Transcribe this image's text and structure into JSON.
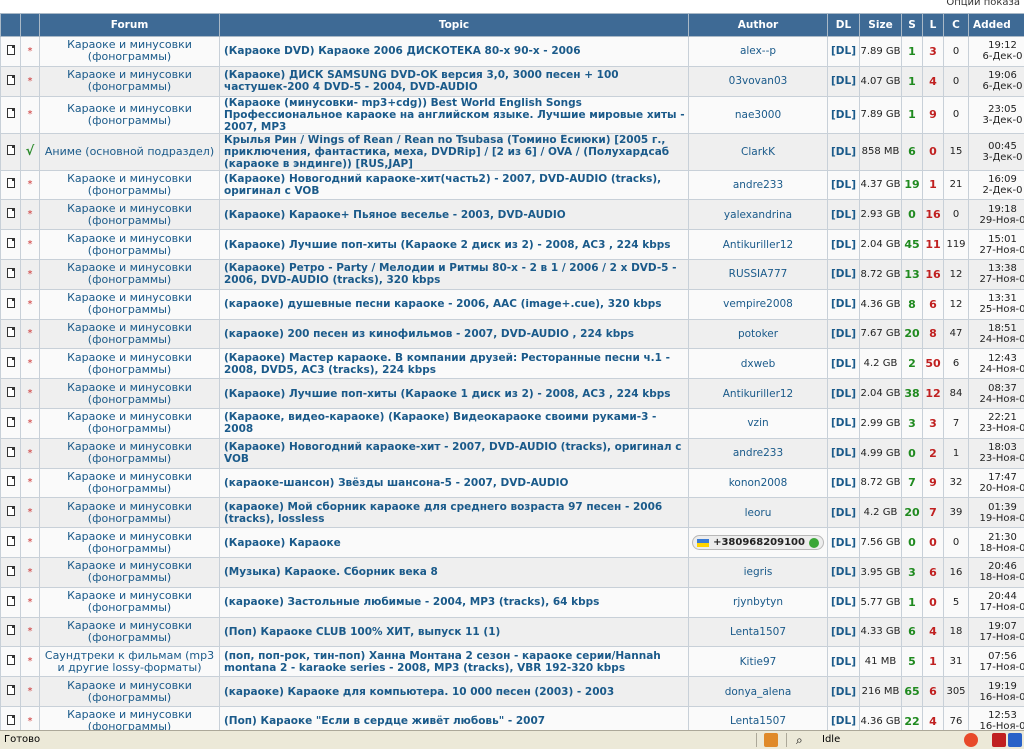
{
  "header": {
    "options_label": "Опции показа"
  },
  "columns": [
    "Forum",
    "Topic",
    "Author",
    "DL",
    "Size",
    "S",
    "L",
    "C",
    "Added"
  ],
  "rows": [
    {
      "status": "*",
      "forum": "Караоке и минусовки (фонограммы)",
      "topic": "(Караоке DVD) Караоке 2006 ДИСКОТЕКА 80-х 90-х - 2006",
      "author": "alex--p",
      "dl": "[DL]",
      "size": "7.89 GB",
      "s": "1",
      "l": "3",
      "c": "0",
      "time": "19:12",
      "date": "6-Дек-0"
    },
    {
      "status": "*",
      "forum": "Караоке и минусовки (фонограммы)",
      "topic": "(Караоке) ДИСК SAMSUNG DVD-OK версия 3,0, 3000 песен + 100 частушек-200 4 DVD-5 - 2004, DVD-AUDIO",
      "author": "03vovan03",
      "dl": "[DL]",
      "size": "4.07 GB",
      "s": "1",
      "l": "4",
      "c": "0",
      "time": "19:06",
      "date": "6-Дек-0"
    },
    {
      "status": "*",
      "forum": "Караоке и минусовки (фонограммы)",
      "topic": "(Караоке (минусовки- mp3+cdg)) Best World English Songs Профессиональное караоке на английском языке. Лучшие мировые хиты - 2007, MP3",
      "author": "nae3000",
      "dl": "[DL]",
      "size": "7.89 GB",
      "s": "1",
      "l": "9",
      "c": "0",
      "time": "23:05",
      "date": "3-Дек-0"
    },
    {
      "status": "√",
      "forum": "Аниме (основной подраздел)",
      "topic": "Крылья Рин / Wings of Rean / Rean no Tsubasa (Томино Ёсиюки) [2005 г., приключения, фантастика, меха, DVDRip] / [2 из 6] / OVA / (Полухардсаб (караоке в эндинге)) [RUS,JAP]",
      "author": "ClarkK",
      "dl": "[DL]",
      "size": "858 MB",
      "s": "6",
      "l": "0",
      "c": "15",
      "time": "00:45",
      "date": "3-Дек-0"
    },
    {
      "status": "*",
      "forum": "Караоке и минусовки (фонограммы)",
      "topic": "(Караоке) Новогодний караоке-хит(часть2) - 2007, DVD-AUDIO (tracks), оригинал с VOB",
      "author": "andre233",
      "dl": "[DL]",
      "size": "4.37 GB",
      "s": "19",
      "l": "1",
      "c": "21",
      "time": "16:09",
      "date": "2-Дек-0"
    },
    {
      "status": "*",
      "forum": "Караоке и минусовки (фонограммы)",
      "topic": "(Караоке) Караоке+ Пьяное веселье - 2003, DVD-AUDIO",
      "author": "yalexandrina",
      "dl": "[DL]",
      "size": "2.93 GB",
      "s": "0",
      "l": "16",
      "c": "0",
      "time": "19:18",
      "date": "29-Ноя-0"
    },
    {
      "status": "*",
      "forum": "Караоке и минусовки (фонограммы)",
      "topic": "(Караоке) Лучшие поп-хиты (Караоке 2 диск из 2) - 2008, AC3 , 224 kbps",
      "author": "Antikuriller12",
      "dl": "[DL]",
      "size": "2.04 GB",
      "s": "45",
      "l": "11",
      "c": "119",
      "time": "15:01",
      "date": "27-Ноя-0"
    },
    {
      "status": "*",
      "forum": "Караоке и минусовки (фонограммы)",
      "topic": "(Караоке) Ретро - Party / Мелодии и Ритмы 80-х - 2 в 1 / 2006 / 2 х DVD-5 - 2006, DVD-AUDIO (tracks), 320 kbps",
      "author": "RUSSIA777",
      "dl": "[DL]",
      "size": "8.72 GB",
      "s": "13",
      "l": "16",
      "c": "12",
      "time": "13:38",
      "date": "27-Ноя-0"
    },
    {
      "status": "*",
      "forum": "Караоке и минусовки (фонограммы)",
      "topic": "(караоке) душевные песни караоке - 2006, AAC (image+.cue), 320 kbps",
      "author": "vempire2008",
      "dl": "[DL]",
      "size": "4.36 GB",
      "s": "8",
      "l": "6",
      "c": "12",
      "time": "13:31",
      "date": "25-Ноя-0"
    },
    {
      "status": "*",
      "forum": "Караоке и минусовки (фонограммы)",
      "topic": "(караоке) 200 песен из кинофильмов - 2007, DVD-AUDIO , 224 kbps",
      "author": "potoker",
      "dl": "[DL]",
      "size": "7.67 GB",
      "s": "20",
      "l": "8",
      "c": "47",
      "time": "18:51",
      "date": "24-Ноя-0"
    },
    {
      "status": "*",
      "forum": "Караоке и минусовки (фонограммы)",
      "topic": "(Караоке) Мастер караоке. В компании друзей: Ресторанные песни ч.1 - 2008, DVD5, AC3 (tracks), 224 kbps",
      "author": "dxweb",
      "dl": "[DL]",
      "size": "4.2 GB",
      "s": "2",
      "l": "50",
      "c": "6",
      "time": "12:43",
      "date": "24-Ноя-0"
    },
    {
      "status": "*",
      "forum": "Караоке и минусовки (фонограммы)",
      "topic": "(Караоке) Лучшие поп-хиты (Караоке 1 диск из 2) - 2008, AC3 , 224 kbps",
      "author": "Antikuriller12",
      "dl": "[DL]",
      "size": "2.04 GB",
      "s": "38",
      "l": "12",
      "c": "84",
      "time": "08:37",
      "date": "24-Ноя-0"
    },
    {
      "status": "*",
      "forum": "Караоке и минусовки (фонограммы)",
      "topic": "(Караоке, видео-караоке) (Караоке) Видеокараоке своими руками-3 - 2008",
      "author": "vzin",
      "dl": "[DL]",
      "size": "2.99 GB",
      "s": "3",
      "l": "3",
      "c": "7",
      "time": "22:21",
      "date": "23-Ноя-0"
    },
    {
      "status": "*",
      "forum": "Караоке и минусовки (фонограммы)",
      "topic": "(Караоке) Новогодний караоке-хит - 2007, DVD-AUDIO (tracks), оригинал с VOB",
      "author": "andre233",
      "dl": "[DL]",
      "size": "4.99 GB",
      "s": "0",
      "l": "2",
      "c": "1",
      "time": "18:03",
      "date": "23-Ноя-0"
    },
    {
      "status": "*",
      "forum": "Караоке и минусовки (фонограммы)",
      "topic": "(караоке-шансон) Звёзды шансона-5 - 2007, DVD-AUDIO",
      "author": "konon2008",
      "dl": "[DL]",
      "size": "8.72 GB",
      "s": "7",
      "l": "9",
      "c": "32",
      "time": "17:47",
      "date": "20-Ноя-0"
    },
    {
      "status": "*",
      "forum": "Караоке и минусовки (фонограммы)",
      "topic": "(караоке) Мой сборник караоке для среднего возраста 97 песен - 2006 (tracks), lossless",
      "author": "leoru",
      "dl": "[DL]",
      "size": "4.2 GB",
      "s": "20",
      "l": "7",
      "c": "39",
      "time": "01:39",
      "date": "19-Ноя-0"
    },
    {
      "status": "*",
      "forum": "Караоке и минусовки (фонограммы)",
      "topic": "(Караоке) Караоке",
      "author": "+380968209100",
      "author_is_phone": true,
      "dl": "[DL]",
      "size": "7.56 GB",
      "s": "0",
      "l": "0",
      "c": "0",
      "time": "21:30",
      "date": "18-Ноя-0"
    },
    {
      "status": "*",
      "forum": "Караоке и минусовки (фонограммы)",
      "topic": "(Музыка) Караоке. Сборник века 8",
      "author": "iegris",
      "dl": "[DL]",
      "size": "3.95 GB",
      "s": "3",
      "l": "6",
      "c": "16",
      "time": "20:46",
      "date": "18-Ноя-0"
    },
    {
      "status": "*",
      "forum": "Караоке и минусовки (фонограммы)",
      "topic": "(караоке) Застольные любимые - 2004, MP3 (tracks), 64 kbps",
      "author": "rjynbytyn",
      "dl": "[DL]",
      "size": "5.77 GB",
      "s": "1",
      "l": "0",
      "c": "5",
      "time": "20:44",
      "date": "17-Ноя-0"
    },
    {
      "status": "*",
      "forum": "Караоке и минусовки (фонограммы)",
      "topic": "(Поп) Караоке CLUB 100% ХИТ, выпуск 11 (1)",
      "author": "Lenta1507",
      "dl": "[DL]",
      "size": "4.33 GB",
      "s": "6",
      "l": "4",
      "c": "18",
      "time": "19:07",
      "date": "17-Ноя-0"
    },
    {
      "status": "*",
      "forum": "Саундтреки к фильмам (mp3 и другие lossy-форматы)",
      "topic": "(поп, поп-рок, тин-поп) Ханна Монтана 2 сезон - караоке серии/Hannah montana 2 - karaoke series - 2008, MP3 (tracks), VBR 192-320 kbps",
      "author": "Kitie97",
      "dl": "[DL]",
      "size": "41 MB",
      "s": "5",
      "l": "1",
      "c": "31",
      "time": "07:56",
      "date": "17-Ноя-0"
    },
    {
      "status": "*",
      "forum": "Караоке и минусовки (фонограммы)",
      "topic": "(караоке) Караоке для компьютера. 10 000 песен (2003) - 2003",
      "author": "donya_alena",
      "dl": "[DL]",
      "size": "216 MB",
      "s": "65",
      "l": "6",
      "c": "305",
      "time": "19:19",
      "date": "16-Ноя-0"
    },
    {
      "status": "*",
      "forum": "Караоке и минусовки (фонограммы)",
      "topic": "(Поп) Караоке \"Если в сердце живёт любовь\" - 2007",
      "author": "Lenta1507",
      "dl": "[DL]",
      "size": "4.36 GB",
      "s": "22",
      "l": "4",
      "c": "76",
      "time": "12:53",
      "date": "16-Ноя-0"
    }
  ],
  "statusbar": {
    "text": "Готово",
    "idle": "Idle"
  },
  "colors": {
    "header_bg": "#3e6a95",
    "link": "#1a5a8a",
    "seed": "#1f8a1f",
    "leech": "#c02020"
  }
}
